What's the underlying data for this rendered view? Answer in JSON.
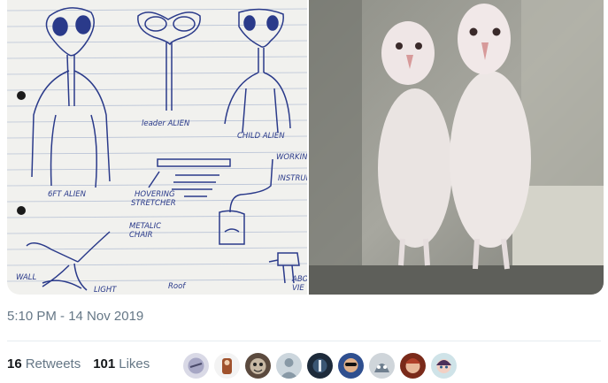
{
  "tweet": {
    "timestamp": "5:10 PM - 14 Nov 2019",
    "retweets_count": "16",
    "retweets_label": "Retweets",
    "likes_count": "101",
    "likes_label": "Likes"
  },
  "media": {
    "sketch_labels": {
      "leader": "leader ALIEN",
      "child": "CHILD ALIEN",
      "six_ft": "6FT ALIEN",
      "hovering_1": "HOVERING",
      "hovering_2": "STRETCHER",
      "working": "WORKING",
      "instrument": "INSTRUM",
      "metallic_1": "METALIC",
      "metallic_2": "CHAIR",
      "wall": "WALL",
      "light": "LIGHT",
      "roof": "Roof",
      "above_1": "ABO",
      "above_2": "VIE"
    }
  },
  "liker_avatars": [
    {
      "icon": "avatar-1"
    },
    {
      "icon": "avatar-2"
    },
    {
      "icon": "avatar-3"
    },
    {
      "icon": "avatar-4"
    },
    {
      "icon": "avatar-5"
    },
    {
      "icon": "avatar-6"
    },
    {
      "icon": "avatar-7"
    },
    {
      "icon": "avatar-8"
    },
    {
      "icon": "avatar-9"
    }
  ],
  "colors": {
    "muted_text": "#657786",
    "paper": "#f3f3f0",
    "ink": "#2a3a8a"
  }
}
